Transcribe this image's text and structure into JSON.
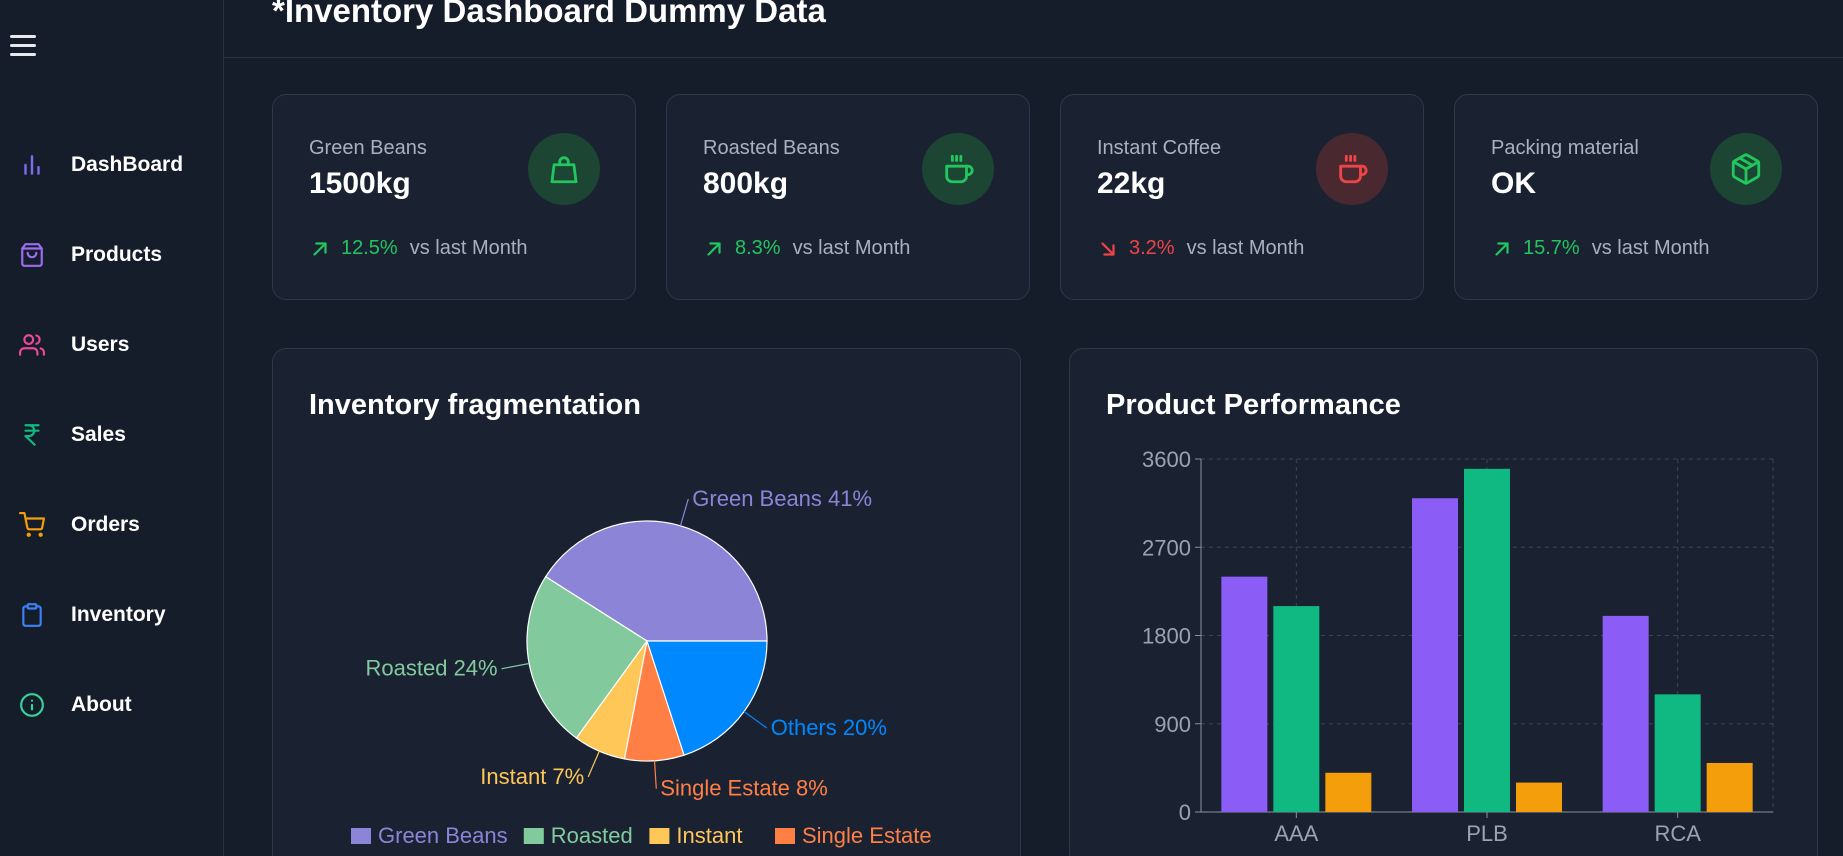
{
  "header": {
    "title": "*Inventory Dashboard Dummy Data"
  },
  "sidebar": {
    "items": [
      {
        "label": "DashBoard",
        "icon": "bar-chart-icon",
        "color": "#7c6cf0"
      },
      {
        "label": "Products",
        "icon": "shopping-bag-icon",
        "color": "#9b6cf0"
      },
      {
        "label": "Users",
        "icon": "users-icon",
        "color": "#ec4899"
      },
      {
        "label": "Sales",
        "icon": "rupee-icon",
        "color": "#10b981"
      },
      {
        "label": "Orders",
        "icon": "shopping-cart-icon",
        "color": "#f59e0b"
      },
      {
        "label": "Inventory",
        "icon": "clipboard-icon",
        "color": "#3b82f6"
      },
      {
        "label": "About",
        "icon": "info-icon",
        "color": "#34d399"
      }
    ]
  },
  "stats": [
    {
      "label": "Green Beans",
      "value": "1500kg",
      "pct": "12.5%",
      "vs": "vs last Month",
      "trend": "up",
      "icon": "shopping-bag-icon",
      "accent": "#22c55e",
      "icon_bg": "#1c4534"
    },
    {
      "label": "Roasted Beans",
      "value": "800kg",
      "pct": "8.3%",
      "vs": "vs last Month",
      "trend": "up",
      "icon": "coffee-cup-icon",
      "accent": "#22c55e",
      "icon_bg": "#1c4534"
    },
    {
      "label": "Instant Coffee",
      "value": "22kg",
      "pct": "3.2%",
      "vs": "vs last Month",
      "trend": "down",
      "icon": "coffee-cup-icon",
      "accent": "#ef4444",
      "icon_bg": "#4a2830"
    },
    {
      "label": "Packing material",
      "value": "OK",
      "pct": "15.7%",
      "vs": "vs last Month",
      "trend": "up",
      "icon": "package-icon",
      "accent": "#22c55e",
      "icon_bg": "#1c4534"
    }
  ],
  "panels": {
    "pie_title": "Inventory fragmentation",
    "bar_title": "Product Performance"
  },
  "chart_data": [
    {
      "type": "pie",
      "title": "Inventory fragmentation",
      "slices": [
        {
          "name": "Green Beans",
          "value": 41,
          "label": "Green Beans 41%",
          "color": "#8b84d7"
        },
        {
          "name": "Roasted",
          "value": 24,
          "label": "Roasted 24%",
          "color": "#82ca9d"
        },
        {
          "name": "Instant",
          "value": 7,
          "label": "Instant 7%",
          "color": "#ffc658"
        },
        {
          "name": "Single Estate",
          "value": 8,
          "label": "Single Estate 8%",
          "color": "#ff7f45"
        },
        {
          "name": "Others",
          "value": 20,
          "label": "Others 20%",
          "color": "#0088fe"
        }
      ],
      "legend": [
        "Green Beans",
        "Roasted",
        "Instant",
        "Single Estate"
      ],
      "legend_placement": "bottom"
    },
    {
      "type": "bar",
      "title": "Product Performance",
      "categories": [
        "AAA",
        "PLB",
        "RCA"
      ],
      "series": [
        {
          "values": [
            2400,
            3200,
            2000
          ],
          "color": "#8b5cf6"
        },
        {
          "values": [
            2100,
            3500,
            1200
          ],
          "color": "#10b981"
        },
        {
          "values": [
            400,
            300,
            500
          ],
          "color": "#f59e0b"
        }
      ],
      "ylim": [
        0,
        3600
      ],
      "yticks": [
        0,
        900,
        1800,
        2700,
        3600
      ],
      "grid": true
    }
  ]
}
